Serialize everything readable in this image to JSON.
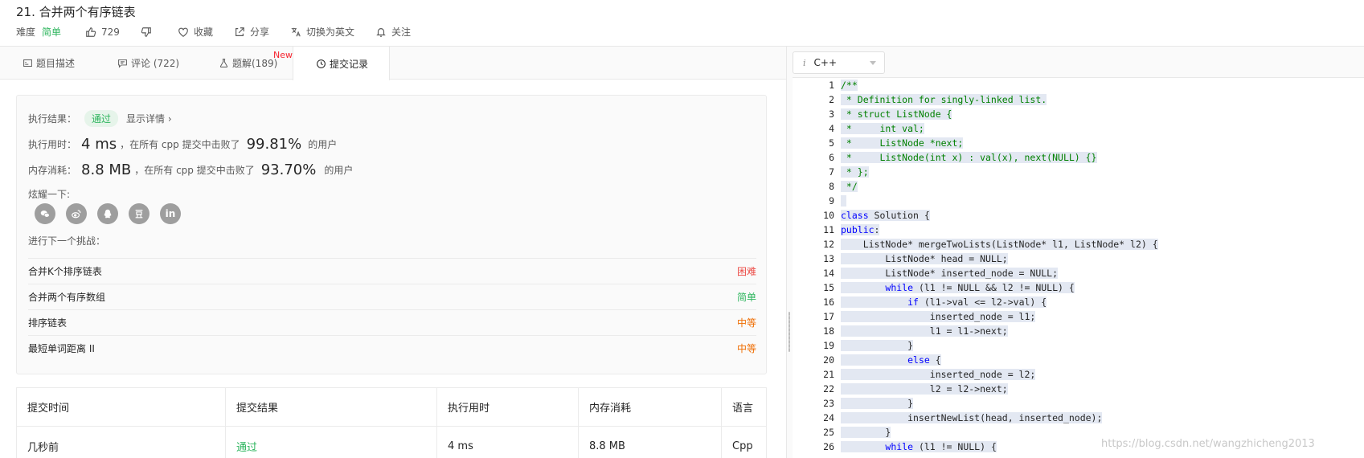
{
  "header": {
    "title": "21. 合并两个有序链表",
    "difficulty_label": "难度",
    "difficulty_value": "简单",
    "likes": "729",
    "favorite_label": "收藏",
    "share_label": "分享",
    "switch_lang_label": "切换为英文",
    "follow_label": "关注"
  },
  "tabs": [
    {
      "label": "题目描述"
    },
    {
      "label": "评论 (722)"
    },
    {
      "label": "题解(189)",
      "badge": "New"
    },
    {
      "label": "提交记录"
    }
  ],
  "result": {
    "label": "执行结果：",
    "status": "通过",
    "detail_link": "显示详情 ›",
    "time_label": "执行用时：",
    "time_value": "4 ms",
    "time_mid": "，在所有 cpp 提交中击败了",
    "time_percent": "99.81%",
    "time_suffix": "的用户",
    "mem_label": "内存消耗：",
    "mem_value": "8.8 MB",
    "mem_mid": "，在所有 cpp 提交中击败了",
    "mem_percent": "93.70%",
    "mem_suffix": "的用户",
    "share_label": "炫耀一下:",
    "next_label": "进行下一个挑战："
  },
  "challenges": [
    {
      "name": "合并K个排序链表",
      "level": "困难",
      "color": "#ec4c47"
    },
    {
      "name": "合并两个有序数组",
      "level": "简单",
      "color": "#2db55d"
    },
    {
      "name": "排序链表",
      "level": "中等",
      "color": "#ef6c00"
    },
    {
      "name": "最短单词距离 II",
      "level": "中等",
      "color": "#ef6c00"
    }
  ],
  "table": {
    "headers": [
      "提交时间",
      "提交结果",
      "执行用时",
      "内存消耗",
      "语言"
    ],
    "rows": [
      [
        "几秒前",
        "通过",
        "4 ms",
        "8.8 MB",
        "Cpp"
      ]
    ]
  },
  "editor": {
    "language": "C++",
    "info_icon": "i",
    "lines": [
      "/**",
      " * Definition for singly-linked list.",
      " * struct ListNode {",
      " *     int val;",
      " *     ListNode *next;",
      " *     ListNode(int x) : val(x), next(NULL) {}",
      " * };",
      " */",
      "",
      "class Solution {",
      "public:",
      "    ListNode* mergeTwoLists(ListNode* l1, ListNode* l2) {",
      "        ListNode* head = NULL;",
      "        ListNode* inserted_node = NULL;",
      "        while (l1 != NULL && l2 != NULL) {",
      "            if (l1->val <= l2->val) {",
      "                inserted_node = l1;",
      "                l1 = l1->next;",
      "            }",
      "            else {",
      "                inserted_node = l2;",
      "                l2 = l2->next;",
      "            }",
      "            insertNewList(head, inserted_node);",
      "        }",
      "        while (l1 != NULL) {"
    ]
  },
  "watermark": "https://blog.csdn.net/wangzhicheng2013"
}
